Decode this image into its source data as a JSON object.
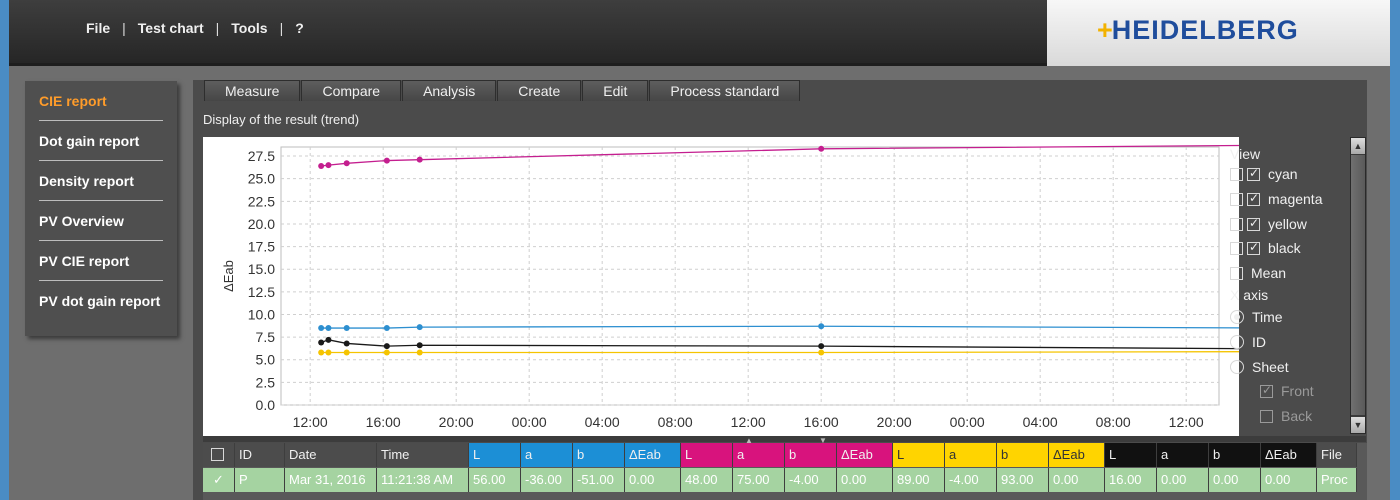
{
  "menu": {
    "file": "File",
    "test_chart": "Test chart",
    "tools": "Tools",
    "help": "?",
    "sep": "|"
  },
  "brand": {
    "name": "HEIDELBERG",
    "mark": "+"
  },
  "sidebar": {
    "items": [
      {
        "label": "CIE report",
        "active": true
      },
      {
        "label": "Dot gain report",
        "active": false
      },
      {
        "label": "Density report",
        "active": false
      },
      {
        "label": "PV Overview",
        "active": false
      },
      {
        "label": "PV CIE report",
        "active": false
      },
      {
        "label": "PV dot gain report",
        "active": false
      }
    ]
  },
  "tabs": [
    "Measure",
    "Compare",
    "Analysis",
    "Create",
    "Edit",
    "Process standard"
  ],
  "subtitle": "Display of the result (trend)",
  "chart_data": {
    "type": "line",
    "title": "",
    "xlabel": "",
    "ylabel": "ΔEab",
    "ylim": [
      0,
      28.5
    ],
    "yticks": [
      "0.0",
      "2.5",
      "5.0",
      "7.5",
      "10.0",
      "12.5",
      "15.0",
      "17.5",
      "20.0",
      "22.5",
      "25.0",
      "27.5"
    ],
    "x_tick_labels": [
      "12:00",
      "16:00",
      "20:00",
      "00:00",
      "04:00",
      "08:00",
      "12:00",
      "16:00",
      "20:00",
      "00:00",
      "04:00",
      "08:00",
      "12:00"
    ],
    "x_hours": [
      0.6,
      1.0,
      2.0,
      4.2,
      6.0,
      28.0,
      53.0
    ],
    "grid": true,
    "series": [
      {
        "name": "magenta",
        "color": "#c41e8f",
        "values": [
          26.4,
          26.5,
          26.7,
          27.0,
          27.1,
          28.3,
          28.7
        ]
      },
      {
        "name": "cyan",
        "color": "#2d8fd0",
        "values": [
          8.5,
          8.5,
          8.5,
          8.5,
          8.6,
          8.7,
          8.5
        ]
      },
      {
        "name": "black",
        "color": "#1a1a1a",
        "values": [
          6.9,
          7.2,
          6.8,
          6.5,
          6.6,
          6.5,
          6.2
        ]
      },
      {
        "name": "yellow",
        "color": "#f5c400",
        "values": [
          5.8,
          5.8,
          5.8,
          5.8,
          5.8,
          5.8,
          5.9
        ]
      }
    ]
  },
  "view": {
    "title": "View",
    "items": [
      {
        "label": "cyan",
        "checked": true
      },
      {
        "label": "magenta",
        "checked": true
      },
      {
        "label": "yellow",
        "checked": true
      },
      {
        "label": "black",
        "checked": true
      }
    ],
    "mean": {
      "label": "Mean",
      "checked": false
    },
    "x_axis": {
      "title": "X axis",
      "options": [
        {
          "label": "Time",
          "selected": true
        },
        {
          "label": "ID",
          "selected": false
        },
        {
          "label": "Sheet",
          "selected": false
        }
      ]
    },
    "front": {
      "label": "Front",
      "checked": true
    },
    "back": {
      "label": "Back",
      "checked": false
    }
  },
  "table": {
    "columns": [
      "",
      "ID",
      "Date",
      "Time",
      "L",
      "a",
      "b",
      "ΔEab",
      "L",
      "a",
      "b",
      "ΔEab",
      "L",
      "a",
      "b",
      "ΔEab",
      "L",
      "a",
      "b",
      "ΔEab",
      "File"
    ],
    "header_colors": [
      "#4c4c4c",
      "#4c4c4c",
      "#4c4c4c",
      "#4c4c4c",
      "#1c8fd6",
      "#1c8fd6",
      "#1c8fd6",
      "#1c8fd6",
      "#d8137d",
      "#d8137d",
      "#d8137d",
      "#d8137d",
      "#ffd400",
      "#ffd400",
      "#ffd400",
      "#ffd400",
      "#111111",
      "#111111",
      "#111111",
      "#111111",
      "#4c4c4c"
    ],
    "rows": [
      [
        "✓",
        "P",
        "Mar 31, 2016",
        "11:21:38 AM",
        "56.00",
        "-36.00",
        "-51.00",
        "0.00",
        "48.00",
        "75.00",
        "-4.00",
        "0.00",
        "89.00",
        "-4.00",
        "93.00",
        "0.00",
        "16.00",
        "0.00",
        "0.00",
        "0.00",
        "Proc"
      ]
    ]
  }
}
